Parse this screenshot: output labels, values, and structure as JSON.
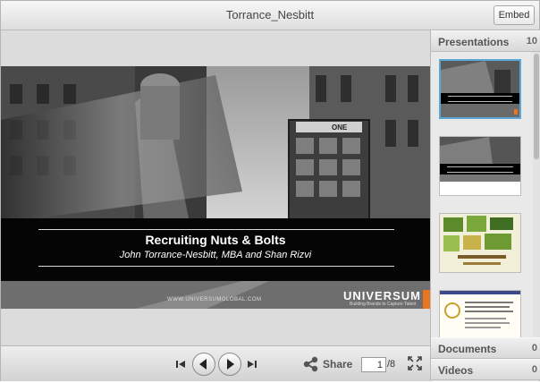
{
  "header": {
    "title": "Torrance_Nesbitt",
    "embed_label": "Embed"
  },
  "slide": {
    "title": "Recruiting Nuts & Bolts",
    "subtitle": "John Torrance-Nesbitt, MBA and Shan Rizvi",
    "url": "WWW.UNIVERSUMGLOBAL.COM",
    "brand": "UNIVERSUM",
    "brand_tagline": "Building Brands to Capture Talent",
    "booth_sign": "ONE"
  },
  "controls": {
    "share_label": "Share",
    "current_page": "1",
    "total_pages": "/8"
  },
  "sidebar": {
    "sections": [
      {
        "label": "Presentations",
        "count": "10"
      },
      {
        "label": "Documents",
        "count": "0"
      },
      {
        "label": "Videos",
        "count": "0"
      }
    ]
  },
  "colors": {
    "accent_selected": "#5aa7d8",
    "brand_orange": "#e8761e"
  }
}
